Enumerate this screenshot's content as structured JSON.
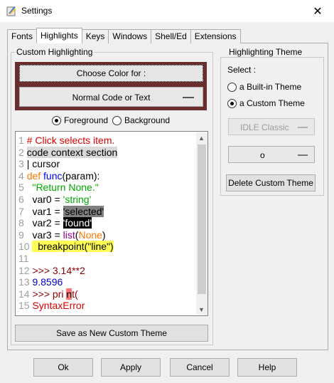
{
  "window": {
    "title": "Settings",
    "close_glyph": "✕"
  },
  "tabs": [
    {
      "label": "Fonts",
      "active": false
    },
    {
      "label": "Highlights",
      "active": true
    },
    {
      "label": "Keys",
      "active": false
    },
    {
      "label": "Windows",
      "active": false
    },
    {
      "label": "Shell/Ed",
      "active": false
    },
    {
      "label": "Extensions",
      "active": false
    }
  ],
  "custom_highlighting": {
    "group_label": "Custom Highlighting",
    "choose_color_label": "Choose Color for :",
    "element_selected": "Normal Code or Text",
    "frame_color": "#6b2e2e",
    "foreground_label": "Foreground",
    "background_label": "Background",
    "foreground_selected": true,
    "save_button": "Save as New Custom Theme"
  },
  "code_sample": [
    {
      "num": "1",
      "parts": [
        {
          "text": "# Click selects item.",
          "fg": "#dd0000"
        }
      ]
    },
    {
      "num": "2",
      "parts": [
        {
          "text": "code context section",
          "fg": "#000000",
          "bg": "#d9d9d9"
        }
      ]
    },
    {
      "num": "3",
      "parts": [
        {
          "text": "| cursor",
          "fg": "#000000"
        }
      ]
    },
    {
      "num": "4",
      "parts": [
        {
          "text": "def",
          "fg": "#ff7700"
        },
        {
          "text": " ",
          "fg": "#000000"
        },
        {
          "text": "func",
          "fg": "#0000ff"
        },
        {
          "text": "(param):",
          "fg": "#000000"
        }
      ]
    },
    {
      "num": "5",
      "parts": [
        {
          "text": "  ",
          "fg": "#000000"
        },
        {
          "text": "\"Return None.\"",
          "fg": "#00aa00"
        }
      ]
    },
    {
      "num": "6",
      "parts": [
        {
          "text": "  var0 = ",
          "fg": "#000000"
        },
        {
          "text": "'string'",
          "fg": "#00aa00"
        }
      ]
    },
    {
      "num": "7",
      "parts": [
        {
          "text": "  var1 = ",
          "fg": "#000000"
        },
        {
          "text": "'selected'",
          "fg": "#000000",
          "bg": "#808080"
        }
      ]
    },
    {
      "num": "8",
      "parts": [
        {
          "text": "  var2 = ",
          "fg": "#000000"
        },
        {
          "text": "'found'",
          "fg": "#ffffff",
          "bg": "#000000"
        }
      ]
    },
    {
      "num": "9",
      "parts": [
        {
          "text": "  var3 = ",
          "fg": "#000000"
        },
        {
          "text": "list",
          "fg": "#900090"
        },
        {
          "text": "(",
          "fg": "#000000"
        },
        {
          "text": "None",
          "fg": "#ff7700"
        },
        {
          "text": ")",
          "fg": "#000000"
        }
      ]
    },
    {
      "num": "10",
      "parts": [
        {
          "text": "  breakpoint(\"line\")",
          "fg": "#000000",
          "bg": "#ffff55"
        }
      ]
    },
    {
      "num": "11",
      "parts": []
    },
    {
      "num": "12",
      "parts": [
        {
          "text": ">>> 3.14**2",
          "fg": "#8b0000"
        }
      ]
    },
    {
      "num": "13",
      "parts": [
        {
          "text": "9.8596",
          "fg": "#0000cc"
        }
      ]
    },
    {
      "num": "14",
      "parts": [
        {
          "text": ">>> pri ",
          "fg": "#8b0000"
        },
        {
          "text": "n",
          "fg": "#000000",
          "bg": "#ff7777"
        },
        {
          "text": "t(",
          "fg": "#8b0000"
        }
      ]
    },
    {
      "num": "15",
      "parts": [
        {
          "text": "SyntaxError",
          "fg": "#dd0000"
        }
      ]
    }
  ],
  "highlighting_theme": {
    "group_label": "Highlighting Theme",
    "select_label": "Select :",
    "builtin_label": "a Built-in Theme",
    "custom_label": "a Custom Theme",
    "custom_selected": true,
    "builtin_value": "IDLE Classic",
    "custom_value": "o",
    "delete_button": "Delete Custom Theme"
  },
  "buttons": {
    "ok": "Ok",
    "apply": "Apply",
    "cancel": "Cancel",
    "help": "Help"
  }
}
